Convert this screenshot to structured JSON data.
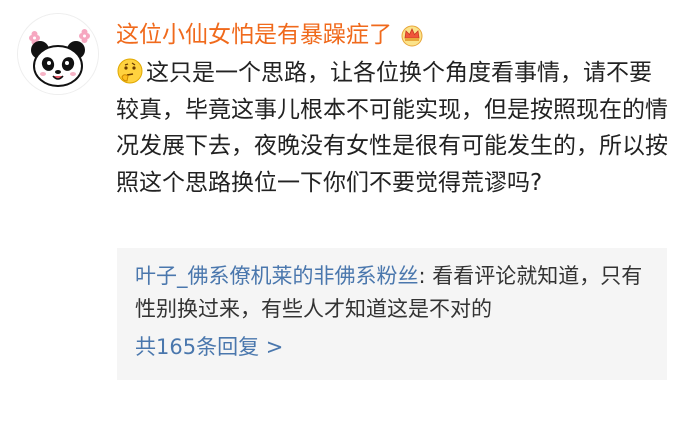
{
  "comment": {
    "username": "这位小仙女怕是有暴躁症了",
    "badge_icon": "crown-icon",
    "avatar_icon": "panda-avatar",
    "emoji": "thinking-emoji-icon",
    "text": "这只是一个思路，让各位换个角度看事情，请不要较真，毕竟这事儿根本不可能实现，但是按照现在的情况发展下去，夜晚没有女性是很有可能发生的，所以按照这个思路换位一下你们不要觉得荒谬吗?"
  },
  "reply": {
    "author": "叶子_佛系僚机莱的非佛系粉丝",
    "separator": ": ",
    "text": "看看评论就知道，只有性别换过来，有些人才知道这是不对的",
    "more_label": "共165条回复 >"
  },
  "colors": {
    "username": "#f06a1c",
    "reply_link": "#4a77ad",
    "reply_background": "#f5f5f5",
    "body_text": "#222222"
  }
}
